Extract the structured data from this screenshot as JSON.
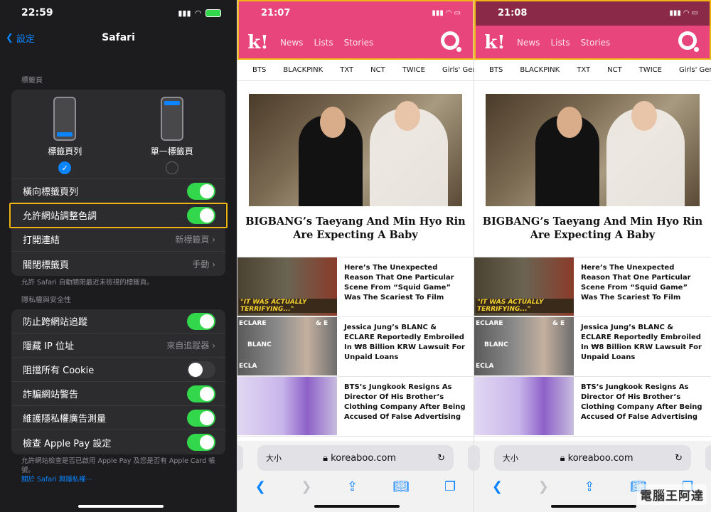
{
  "settings": {
    "status": {
      "time": "22:59"
    },
    "nav": {
      "back_label": "設定",
      "title": "Safari"
    },
    "tabs_section": "標籤頁",
    "tab_options": [
      {
        "label": "標籤頁列",
        "selected": true
      },
      {
        "label": "單一標籤頁",
        "selected": false
      }
    ],
    "rows": [
      {
        "label": "橫向標籤頁列",
        "toggle": "on"
      },
      {
        "label": "允許網站調整色調",
        "toggle": "on"
      },
      {
        "label": "打開連結",
        "value": "新標籤頁"
      },
      {
        "label": "關閉標籤頁",
        "value": "手動"
      }
    ],
    "tabs_note": "允許 Safari 自動關閉最近未檢視的標籤頁。",
    "privacy_section": "隱私權與安全性",
    "privacy_rows": [
      {
        "label": "防止跨網站追蹤",
        "toggle": "on"
      },
      {
        "label": "隱藏 IP 位址",
        "value": "來自追蹤器"
      },
      {
        "label": "阻擋所有 Cookie",
        "toggle": "off"
      },
      {
        "label": "詐騙網站警告",
        "toggle": "on"
      },
      {
        "label": "維護隱私權廣告測量",
        "toggle": "on"
      },
      {
        "label": "檢查 Apple Pay 設定",
        "toggle": "on"
      }
    ],
    "privacy_note": "允許網站檢查是否已啟用 Apple Pay 及您是否有 Apple Card 帳號。",
    "privacy_link": "關於 Safari 與隱私權⋯"
  },
  "browser_left": {
    "time": "21:07"
  },
  "browser_right": {
    "time": "21:08"
  },
  "site": {
    "logo": "k!",
    "nav": [
      "News",
      "Lists",
      "Stories"
    ],
    "categories": [
      "BTS",
      "BLACKPINK",
      "TXT",
      "NCT",
      "TWICE",
      "Girls' Genera"
    ],
    "headline": "BIGBANG’s Taeyang And Min Hyo Rin Are Expecting A Baby",
    "articles": [
      {
        "title": "Here’s The Unexpected Reason That One Particular Scene From “Squid Game” Was The Scariest To Film",
        "thumb_caption": "\"IT WAS ACTUALLY TERRIFYING...\""
      },
      {
        "title": "Jessica Jung’s BLANC & ECLARE Reportedly Embroiled In ₩8 Billion KRW Lawsuit For Unpaid Loans",
        "thumb_words": [
          "ECLARE",
          "BLANC",
          "ECLA",
          "& E"
        ]
      },
      {
        "title": "BTS’s Jungkook Resigns As Director Of His Brother’s Clothing Company After Being Accused Of False Advertising"
      }
    ],
    "url_text_size": "大小",
    "url": "koreaboo.com",
    "colors": {
      "brand_left": "#e9457d",
      "brand_right": "#e9457d",
      "status_bar_right": "#8a2a48",
      "highlight": "#f0b414"
    }
  },
  "watermark": "電腦王阿達"
}
